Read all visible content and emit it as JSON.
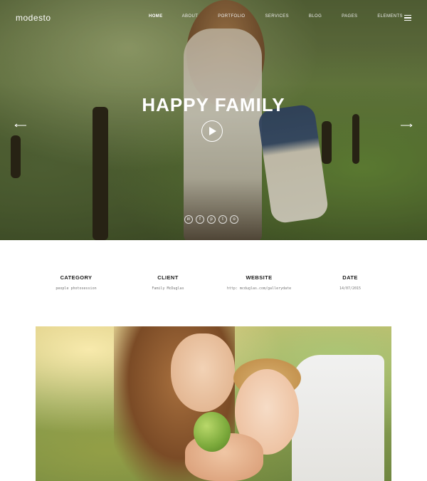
{
  "brand": {
    "logo": "modesto"
  },
  "nav": {
    "items": [
      {
        "label": "HOME",
        "active": true
      },
      {
        "label": "ABOUT",
        "active": false
      },
      {
        "label": "PORTFOLIO",
        "active": false
      },
      {
        "label": "SERVICES",
        "active": false
      },
      {
        "label": "BLOG",
        "active": false
      },
      {
        "label": "PAGES",
        "active": false
      },
      {
        "label": "ELEMENTS",
        "active": false
      }
    ],
    "menu_icon": "hamburger-icon"
  },
  "hero": {
    "title": "HAPPY FAMILY",
    "play_icon": "play-icon",
    "prev_icon": "arrow-left-icon",
    "next_icon": "arrow-right-icon",
    "social": [
      {
        "icon": "linkedin-icon",
        "glyph": "in"
      },
      {
        "icon": "facebook-icon",
        "glyph": "f"
      },
      {
        "icon": "pinterest-icon",
        "glyph": "p"
      },
      {
        "icon": "twitter-icon",
        "glyph": "t"
      },
      {
        "icon": "instagram-icon",
        "glyph": "o"
      }
    ]
  },
  "project_info": [
    {
      "label": "CATEGORY",
      "value": "people photosession"
    },
    {
      "label": "CLIENT",
      "value": "Family McDuglas"
    },
    {
      "label": "WEBSITE",
      "value": "http: mcduglas.com/gallerydate"
    },
    {
      "label": "DATE",
      "value": "14/07/2015"
    }
  ],
  "colors": {
    "accent": "#ffffff",
    "text": "#1a1a1a",
    "muted": "#777777"
  }
}
